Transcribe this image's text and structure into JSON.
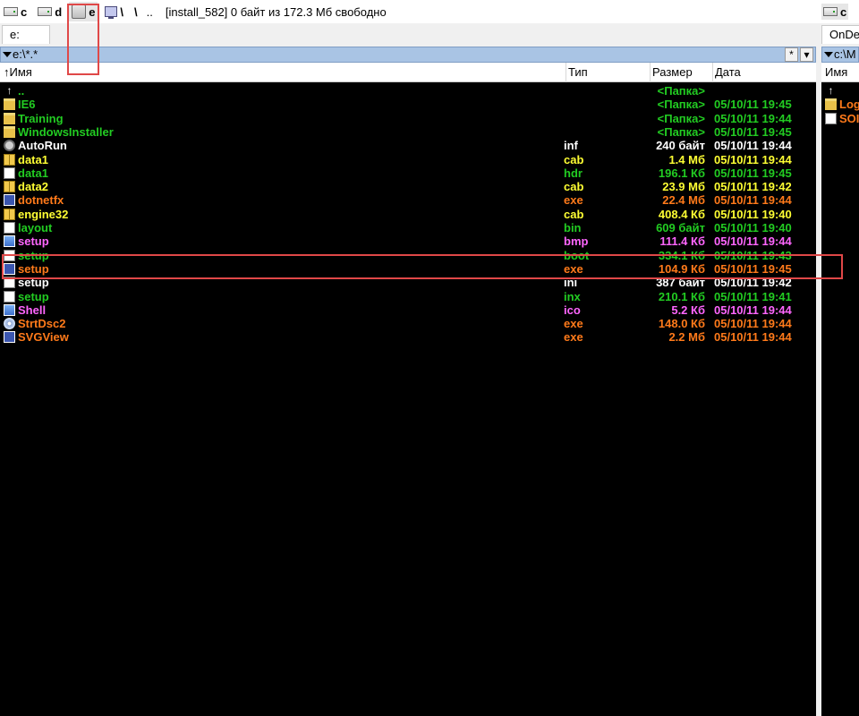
{
  "drivebar": {
    "drives": [
      {
        "letter": "c",
        "icon": "hard-drive-icon"
      },
      {
        "letter": "d",
        "icon": "hard-drive-icon"
      },
      {
        "letter": "e",
        "icon": "cd-drive-icon"
      }
    ],
    "network_icon": "network-icon",
    "backslash": "\\",
    "root_sep": "\\",
    "up_sep": "..",
    "free_info": "[install_582]  0 байт из 172.3 Мб свободно",
    "right_drive_letter": "c"
  },
  "left_panel": {
    "tab_label": "e:",
    "path": "e:\\*.*",
    "filter_btn": "*",
    "dropdown_btn": "▾",
    "columns": {
      "name": "↑Имя",
      "type": "Тип",
      "size": "Размер",
      "date": "Дата"
    },
    "files": [
      {
        "name": "..",
        "type": "",
        "size": "<Папка>",
        "date": "",
        "icon": "up-arrow-icon",
        "color": "#22cc22"
      },
      {
        "name": "IE6",
        "type": "",
        "size": "<Папка>",
        "date": "05/10/11 19:45",
        "icon": "folder-icon",
        "color": "#22cc22"
      },
      {
        "name": "Training",
        "type": "",
        "size": "<Папка>",
        "date": "05/10/11 19:44",
        "icon": "folder-icon",
        "color": "#22cc22"
      },
      {
        "name": "WindowsInstaller",
        "type": "",
        "size": "<Папка>",
        "date": "05/10/11 19:45",
        "icon": "folder-icon",
        "color": "#22cc22"
      },
      {
        "name": "AutoRun",
        "type": "inf",
        "size": "240 байт",
        "date": "05/10/11 19:44",
        "icon": "gear-doc-icon",
        "color": "#ffffff"
      },
      {
        "name": "data1",
        "type": "cab",
        "size": "1.4 Мб",
        "date": "05/10/11 19:44",
        "icon": "cab-icon",
        "color": "#ffff33"
      },
      {
        "name": "data1",
        "type": "hdr",
        "size": "196.1 Кб",
        "date": "05/10/11 19:45",
        "icon": "document-icon",
        "color": "#22cc22"
      },
      {
        "name": "data2",
        "type": "cab",
        "size": "23.9 Мб",
        "date": "05/10/11 19:42",
        "icon": "cab-icon",
        "color": "#ffff33"
      },
      {
        "name": "dotnetfx",
        "type": "exe",
        "size": "22.4 Мб",
        "date": "05/10/11 19:44",
        "icon": "app-icon",
        "color": "#ff7a1a"
      },
      {
        "name": "engine32",
        "type": "cab",
        "size": "408.4 Кб",
        "date": "05/10/11 19:40",
        "icon": "cab-icon",
        "color": "#ffff33"
      },
      {
        "name": "layout",
        "type": "bin",
        "size": "609 байт",
        "date": "05/10/11 19:40",
        "icon": "document-icon",
        "color": "#22cc22"
      },
      {
        "name": "setup",
        "type": "bmp",
        "size": "111.4 Кб",
        "date": "05/10/11 19:44",
        "icon": "image-icon",
        "color": "#ff66ff"
      },
      {
        "name": "setup",
        "type": "boot",
        "size": "334.1 Кб",
        "date": "05/10/11 19:43",
        "icon": "document-icon",
        "color": "#22cc22"
      },
      {
        "name": "setup",
        "type": "exe",
        "size": "104.9 Кб",
        "date": "05/10/11 19:45",
        "icon": "setup-icon",
        "color": "#ff7a1a"
      },
      {
        "name": "setup",
        "type": "ini",
        "size": "387 байт",
        "date": "05/10/11 19:42",
        "icon": "ini-icon",
        "color": "#ffffff"
      },
      {
        "name": "setup",
        "type": "inx",
        "size": "210.1 Кб",
        "date": "05/10/11 19:41",
        "icon": "document-icon",
        "color": "#22cc22"
      },
      {
        "name": "Shell",
        "type": "ico",
        "size": "5.2 Кб",
        "date": "05/10/11 19:44",
        "icon": "ico-icon",
        "color": "#ff66ff"
      },
      {
        "name": "StrtDsc2",
        "type": "exe",
        "size": "148.0 Кб",
        "date": "05/10/11 19:44",
        "icon": "disc-icon",
        "color": "#ff7a1a"
      },
      {
        "name": "SVGView",
        "type": "exe",
        "size": "2.2 Мб",
        "date": "05/10/11 19:44",
        "icon": "app-icon",
        "color": "#ff7a1a"
      }
    ]
  },
  "right_panel": {
    "tab_label": "OnDe",
    "path": "c:\\M",
    "column_name": "Имя",
    "files": [
      {
        "name": "",
        "icon": "up-arrow-icon",
        "color": "#ffffff"
      },
      {
        "name": "Log",
        "icon": "folder-icon",
        "color": "#ff7a1a"
      },
      {
        "name": "SOI",
        "icon": "document-icon",
        "color": "#ff7a1a"
      }
    ]
  },
  "colors": {
    "folder": "#22cc22",
    "exe": "#ff7a1a",
    "cab": "#ffff33",
    "image": "#ff66ff",
    "highlight": "#d7353b",
    "path_bar": "#a9c4e4"
  }
}
